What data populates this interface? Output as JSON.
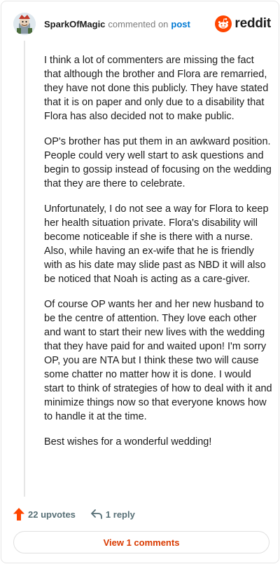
{
  "header": {
    "username": "SparkOfMagic",
    "verb": "commented on",
    "target": "post",
    "brand": "reddit",
    "avatar_icon": "avatar-icon",
    "brand_icon": "reddit-snoo-icon"
  },
  "comment": {
    "paragraphs": [
      "I think a lot of commenters are missing the fact that although the brother and Flora are remarried, they have not done this publicly. They have stated that it is on paper and only due to a disability that Flora has also decided not to make public.",
      "OP's brother has put them in an awkward position. People could very well start to ask questions and begin to gossip instead of focusing on the wedding that they are there to celebrate.",
      "Unfortunately, I do not see a way for Flora to keep her health situation private. Flora's disability will become noticeable if she is there with a nurse. Also, while having an ex-wife that he is friendly with as his date may slide past as NBD it will also be noticed that Noah is acting as a care-giver.",
      "Of course OP wants her and her new husband to be the centre of attention. They love each other and want to start their new lives with the wedding that they have paid for and waited upon! I'm sorry OP, you are NTA but I think these two will cause some chatter no matter how it is done. I would start to think of strategies of how to deal with it and minimize things now so that everyone knows how to handle it at the time.",
      "Best wishes for a wonderful wedding!"
    ]
  },
  "actions": {
    "upvotes": "22 upvotes",
    "replies": "1 reply",
    "upvote_icon": "upvote-arrow-icon",
    "reply_icon": "reply-arrow-icon"
  },
  "footer": {
    "view_label": "View 1 comments"
  },
  "colors": {
    "brand_orange": "#ff4500",
    "link_blue": "#0079d3",
    "button_text": "#d93a00",
    "muted": "#7c7c7c"
  }
}
